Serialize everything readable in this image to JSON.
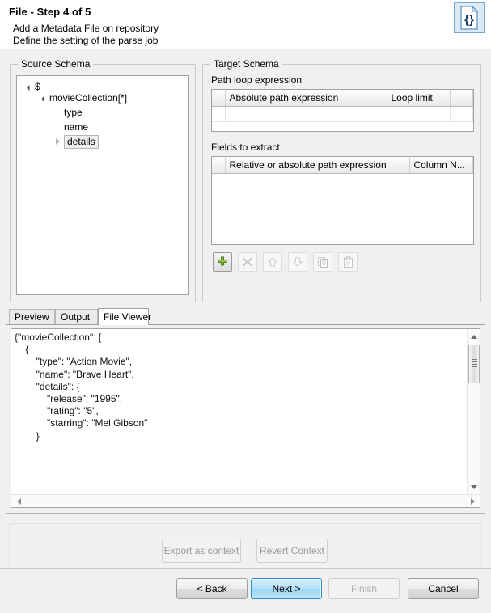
{
  "header": {
    "title_main": "File",
    "title_sep": " - ",
    "title_step": "Step 4 of 5",
    "subtitle1": "Add a Metadata File on repository",
    "subtitle2": "Define the setting of the parse job",
    "icon": "json-file-icon"
  },
  "source_schema": {
    "group_label": "Source Schema",
    "tree": [
      {
        "label": "$",
        "depth": 0,
        "state": "expanded",
        "selected": false
      },
      {
        "label": "movieCollection[*]",
        "depth": 1,
        "state": "expanded",
        "selected": false
      },
      {
        "label": "type",
        "depth": 2,
        "state": "leaf",
        "selected": false
      },
      {
        "label": "name",
        "depth": 2,
        "state": "leaf",
        "selected": false
      },
      {
        "label": "details",
        "depth": 2,
        "state": "collapsed",
        "selected": true
      }
    ]
  },
  "target_schema": {
    "group_label": "Target Schema",
    "path_loop": {
      "label": "Path loop expression",
      "columns": [
        "Absolute path expression",
        "Loop limit"
      ],
      "rows": [
        {
          "absolute_path_expression": "",
          "loop_limit": ""
        }
      ]
    },
    "fields_to_extract": {
      "label": "Fields to extract",
      "columns": [
        "Relative or absolute path expression",
        "Column N..."
      ],
      "rows": [],
      "toolbar": [
        {
          "name": "add-field-button",
          "icon": "plus-icon",
          "enabled": true
        },
        {
          "name": "delete-field-button",
          "icon": "cross-icon",
          "enabled": false
        },
        {
          "name": "move-up-button",
          "icon": "arrow-up-icon",
          "enabled": false
        },
        {
          "name": "move-down-button",
          "icon": "arrow-down-icon",
          "enabled": false
        },
        {
          "name": "copy-button",
          "icon": "copy-icon",
          "enabled": false
        },
        {
          "name": "paste-button",
          "icon": "paste-icon",
          "enabled": false
        }
      ]
    }
  },
  "viewer": {
    "tabs": [
      {
        "label": "Preview",
        "active": false
      },
      {
        "label": "Output",
        "active": false
      },
      {
        "label": "File Viewer",
        "active": true
      }
    ],
    "file_content": "{\"movieCollection\": [\n    {\n        \"type\": \"Action Movie\",\n        \"name\": \"Brave Heart\",\n        \"details\": {\n            \"release\": \"1995\",\n            \"rating\": \"5\",\n            \"starring\": \"Mel Gibson\"\n        }"
  },
  "context_actions": {
    "export_label": "Export as context",
    "revert_label": "Revert Context"
  },
  "footer": {
    "back_label": "< Back",
    "next_label": "Next >",
    "finish_label": "Finish",
    "cancel_label": "Cancel"
  }
}
